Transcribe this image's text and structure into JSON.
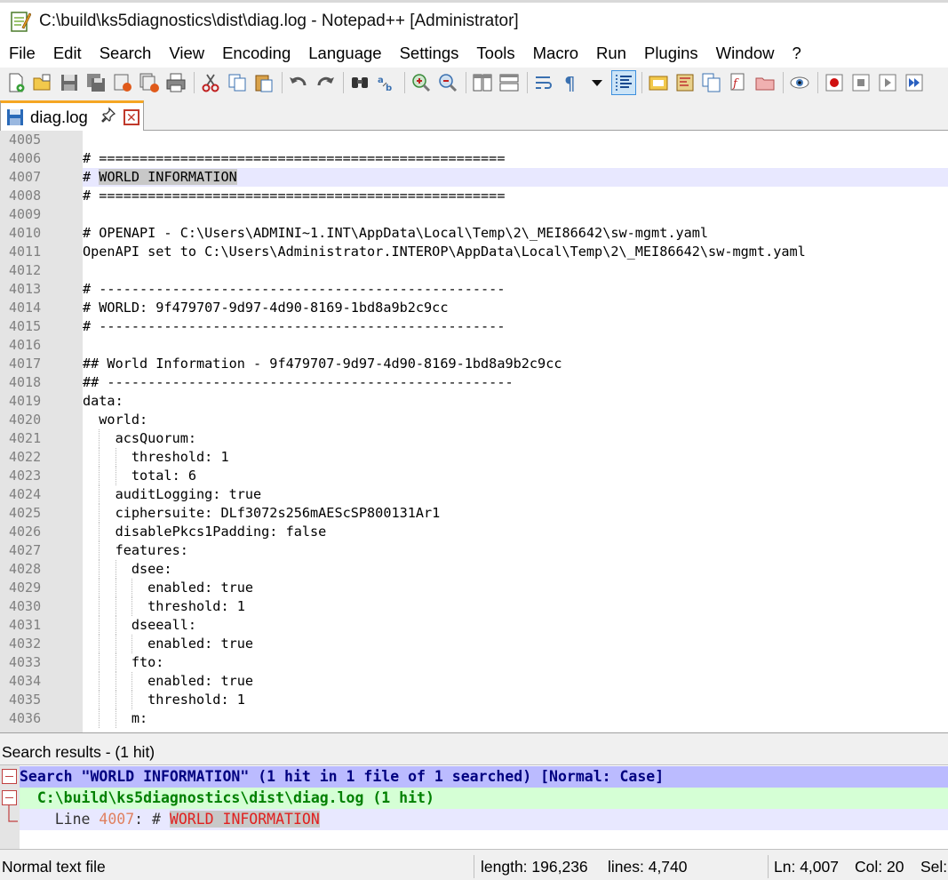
{
  "window": {
    "title": "C:\\build\\ks5diagnostics\\dist\\diag.log - Notepad++ [Administrator]"
  },
  "menu": [
    "File",
    "Edit",
    "Search",
    "View",
    "Encoding",
    "Language",
    "Settings",
    "Tools",
    "Macro",
    "Run",
    "Plugins",
    "Window",
    "?"
  ],
  "toolbar_icons": [
    "new-file-icon",
    "open-file-icon",
    "save-icon",
    "save-all-icon",
    "close-icon",
    "close-all-icon",
    "print-icon",
    "cut-icon",
    "copy-icon",
    "paste-icon",
    "undo-icon",
    "redo-icon",
    "find-icon",
    "replace-icon",
    "zoom-in-icon",
    "zoom-out-icon",
    "sync-vertical-icon",
    "sync-horizontal-icon",
    "word-wrap-icon",
    "show-all-chars-icon",
    "indent-guide-icon",
    "user-defined-language-icon",
    "document-map-icon",
    "document-list-icon",
    "function-list-icon",
    "folder-as-workspace-icon",
    "monitoring-icon",
    "record-macro-icon",
    "stop-macro-icon",
    "play-macro-icon",
    "run-macro-multiple-icon"
  ],
  "tab": {
    "label": "diag.log",
    "pin": "📌",
    "close": "✕"
  },
  "editor": {
    "current_line": "4007",
    "lines": [
      {
        "n": "4005",
        "text": ""
      },
      {
        "n": "4006",
        "text": "# =================================================="
      },
      {
        "n": "4007",
        "text": "# WORLD INFORMATION"
      },
      {
        "n": "4008",
        "text": "# =================================================="
      },
      {
        "n": "4009",
        "text": ""
      },
      {
        "n": "4010",
        "text": "# OPENAPI - C:\\Users\\ADMINI~1.INT\\AppData\\Local\\Temp\\2\\_MEI86642\\sw-mgmt.yaml"
      },
      {
        "n": "4011",
        "text": "OpenAPI set to C:\\Users\\Administrator.INTEROP\\AppData\\Local\\Temp\\2\\_MEI86642\\sw-mgmt.yaml"
      },
      {
        "n": "4012",
        "text": ""
      },
      {
        "n": "4013",
        "text": "# --------------------------------------------------"
      },
      {
        "n": "4014",
        "text": "# WORLD: 9f479707-9d97-4d90-8169-1bd8a9b2c9cc"
      },
      {
        "n": "4015",
        "text": "# --------------------------------------------------"
      },
      {
        "n": "4016",
        "text": ""
      },
      {
        "n": "4017",
        "text": "## World Information - 9f479707-9d97-4d90-8169-1bd8a9b2c9cc"
      },
      {
        "n": "4018",
        "text": "## --------------------------------------------------"
      },
      {
        "n": "4019",
        "text": "data:"
      },
      {
        "n": "4020",
        "text": "  world:"
      },
      {
        "n": "4021",
        "text": "    acsQuorum:"
      },
      {
        "n": "4022",
        "text": "      threshold: 1"
      },
      {
        "n": "4023",
        "text": "      total: 6"
      },
      {
        "n": "4024",
        "text": "    auditLogging: true"
      },
      {
        "n": "4025",
        "text": "    ciphersuite: DLf3072s256mAEScSP800131Ar1"
      },
      {
        "n": "4026",
        "text": "    disablePkcs1Padding: false"
      },
      {
        "n": "4027",
        "text": "    features:"
      },
      {
        "n": "4028",
        "text": "      dsee:"
      },
      {
        "n": "4029",
        "text": "        enabled: true"
      },
      {
        "n": "4030",
        "text": "        threshold: 1"
      },
      {
        "n": "4031",
        "text": "      dseeall:"
      },
      {
        "n": "4032",
        "text": "        enabled: true"
      },
      {
        "n": "4033",
        "text": "      fto:"
      },
      {
        "n": "4034",
        "text": "        enabled: true"
      },
      {
        "n": "4035",
        "text": "        threshold: 1"
      },
      {
        "n": "4036",
        "text": "      m:"
      }
    ]
  },
  "search_results": {
    "title": "Search results - (1 hit)",
    "header": "Search \"WORLD INFORMATION\" (1 hit in 1 file of 1 searched) [Normal: Case]",
    "file_line": "  C:\\build\\ks5diagnostics\\dist\\diag.log (1 hit)",
    "hit_prefix": "    Line ",
    "hit_line_no": "4007",
    "hit_mid": ": # ",
    "hit_match": "WORLD INFORMATION"
  },
  "status": {
    "file_type": "Normal text file",
    "length": "length: 196,236",
    "lines": "lines: 4,740",
    "ln": "Ln: 4,007",
    "col": "Col: 20",
    "sel": "Sel:"
  },
  "colors": {
    "current_line_bg": "#e8e8ff",
    "match_highlight_bg": "#c8c8c8",
    "search_header_bg": "#bbbbff",
    "search_file_bg": "#d5ffd5",
    "tab_accent": "#f5a623"
  }
}
